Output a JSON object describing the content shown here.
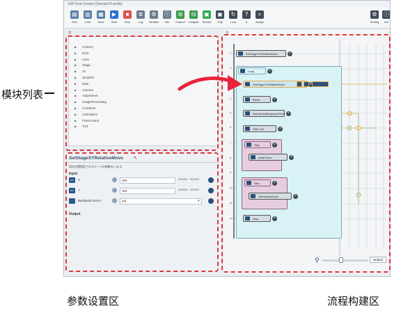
{
  "window": {
    "title": "EM Flow Creator [Sample2/Lavide]"
  },
  "toolbar": {
    "buttons": [
      {
        "label": "New",
        "color": "#5b7fa6",
        "glyph": "▤"
      },
      {
        "label": "Load",
        "color": "#5b7fa6",
        "glyph": "▥"
      },
      {
        "label": "Save",
        "color": "#5b7fa6",
        "glyph": "▦"
      },
      {
        "label": "Start",
        "color": "#2a6fd6",
        "glyph": "▶"
      },
      {
        "label": "Stop",
        "color": "#d9534f",
        "glyph": "■"
      },
      {
        "label": "Log",
        "color": "#6b7b8c",
        "glyph": "≣"
      },
      {
        "label": "Variable",
        "color": "#6b7b8c",
        "glyph": "⚙"
      },
      {
        "label": "Info",
        "color": "#6b7b8c",
        "glyph": "ⓘ"
      },
      {
        "label": "Expand",
        "color": "#3a9a4a",
        "glyph": "⊞"
      },
      {
        "label": "Collapse",
        "color": "#3a9a4a",
        "glyph": "⊟"
      },
      {
        "label": "Nested",
        "color": "#2fa84f",
        "glyph": "▣"
      },
      {
        "label": "Trap",
        "color": "#3e4a56",
        "glyph": "▣"
      },
      {
        "label": "Loop",
        "color": "#3e4a56",
        "glyph": "↻"
      },
      {
        "label": "If",
        "color": "#3e4a56",
        "glyph": "?"
      },
      {
        "label": "Assign",
        "color": "#3e4a56",
        "glyph": "="
      }
    ],
    "right_buttons": [
      {
        "label": "Setting",
        "glyph": "⚙"
      },
      {
        "label": "Info",
        "glyph": "ⓘ"
      }
    ]
  },
  "module_list": {
    "items": [
      "Column",
      "EOS",
      "Lens",
      "Stage",
      "Air",
      "SimpRel",
      "Raw",
      "Camera",
      "Adjustment",
      "ImageProcessing",
      "Container",
      "Calculation",
      "FlowControl",
      "Tool"
    ]
  },
  "params": {
    "tab_title": "SetStageXYRelativeMove",
    "description": "相対位置指定でのステージの移動をします。",
    "input_heading": "Input",
    "output_heading": "Output",
    "fields": [
      {
        "tag": "X/Y",
        "name": "X",
        "value": "300",
        "range": "-300000 ~ 300000"
      },
      {
        "tag": "X/Y",
        "name": "Y",
        "value": "300",
        "range": "-300000 ~ 300000"
      },
      {
        "tag": "",
        "name": "BacklashCorrect",
        "value": "Off",
        "range": ""
      }
    ]
  },
  "flow": {
    "nodes": [
      {
        "label": "SetStageXYRelativeMove"
      },
      {
        "label": "Loop"
      },
      {
        "label": "SetStageXYRelativeMove"
      },
      {
        "label": "Break"
      },
      {
        "label": "SetCameraExposureTime"
      },
      {
        "label": "Start Cal"
      },
      {
        "label": "Skip"
      },
      {
        "label": "AutoFocus"
      },
      {
        "label": "Skip"
      },
      {
        "label": "SetCameraGain"
      },
      {
        "label": "Stop"
      }
    ],
    "line_numbers": [
      "1",
      "2",
      "3",
      "4",
      "5",
      "6",
      "7",
      "8",
      "9",
      "10",
      "11",
      "12"
    ],
    "default_button": "Default"
  },
  "annotations": {
    "module_list": "模块列表",
    "params": "参数设置区",
    "flow": "流程构建区"
  }
}
